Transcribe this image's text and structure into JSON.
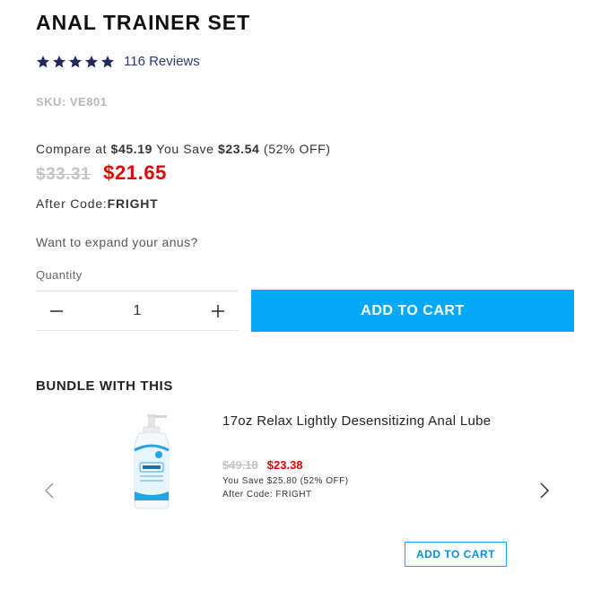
{
  "product": {
    "title": "ANAL TRAINER SET",
    "rating": 5,
    "reviews_label": "116 Reviews",
    "sku": "SKU: VE801",
    "compare_prefix": "Compare at ",
    "compare_price": "$45.19",
    "save_prefix": " You Save ",
    "save_amount": "$23.54",
    "save_percent": " (52% OFF)",
    "old_price": "$33.31",
    "new_price": "$21.65",
    "after_code_label": "After Code:",
    "after_code": "FRIGHT",
    "tagline": "Want to expand your anus?",
    "quantity_label": "Quantity",
    "quantity_value": "1",
    "add_to_cart_label": "ADD TO CART"
  },
  "bundle": {
    "heading": "BUNDLE WITH THIS",
    "item": {
      "name": "17oz Relax Lightly Desensitizing Anal Lube",
      "old_price": "$49.18",
      "new_price": "$23.38",
      "savings": "You Save $25.80 (52% OFF)",
      "after_code": "After Code: FRIGHT",
      "add_to_cart_label": "ADD TO CART"
    }
  },
  "colors": {
    "accent": "#03a9f4",
    "sale": "#e10000",
    "stars": "#1f2a5c"
  },
  "icons": {
    "star": "star-icon",
    "minus": "minus-icon",
    "plus": "plus-icon",
    "prev": "chevron-left-icon",
    "next": "chevron-right-icon"
  }
}
